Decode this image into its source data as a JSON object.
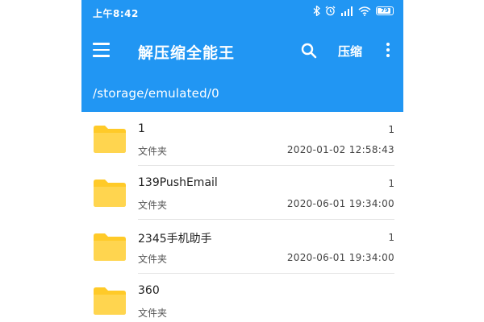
{
  "status_bar": {
    "time": "上午8:42",
    "battery_level": "79",
    "icons": [
      "bluetooth-icon",
      "alarm-icon",
      "signal-icon",
      "wifi-icon",
      "battery-icon"
    ]
  },
  "toolbar": {
    "title": "解压缩全能王",
    "compress_label": "压缩",
    "icons": [
      "menu-icon",
      "search-icon",
      "more-vert-icon"
    ]
  },
  "path": "/storage/emulated/0",
  "colors": {
    "primary": "#2196F3",
    "folder": "#FFCA28"
  },
  "files": [
    {
      "name": "1",
      "type": "文件夹",
      "count": "1",
      "date": "2020-01-02 12:58:43"
    },
    {
      "name": "139PushEmail",
      "type": "文件夹",
      "count": "1",
      "date": "2020-06-01 19:34:00"
    },
    {
      "name": "2345手机助手",
      "type": "文件夹",
      "count": "1",
      "date": "2020-06-01 19:34:00"
    },
    {
      "name": "360",
      "type": "文件夹",
      "count": "",
      "date": ""
    }
  ]
}
